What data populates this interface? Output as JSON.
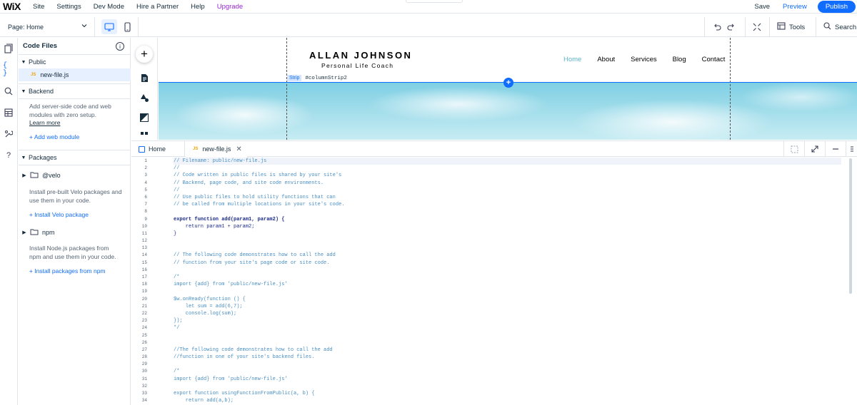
{
  "topbar": {
    "logo": "WiX",
    "menu": [
      "Site",
      "Settings",
      "Dev Mode",
      "Hire a Partner",
      "Help",
      "Upgrade"
    ],
    "save": "Save",
    "preview": "Preview",
    "publish": "Publish"
  },
  "secondbar": {
    "page_label": "Page: Home",
    "tools": "Tools",
    "search": "Search"
  },
  "files_panel": {
    "title": "Code Files",
    "public": "Public",
    "public_file": "new-file.js",
    "js_badge": "JS",
    "backend": "Backend",
    "backend_desc": "Add server-side code and web modules with zero setup.",
    "learn_more": "Learn more",
    "add_web_module": "+ Add web module",
    "packages": "Packages",
    "velo": "@velo",
    "velo_desc": "Install pre-built Velo packages and use them in your code.",
    "install_velo": "+ Install Velo package",
    "npm": "npm",
    "npm_desc": "Install Node.js packages from npm and use them in your code.",
    "install_npm": "+ Install packages from npm"
  },
  "canvas": {
    "site_name": "ALLAN JOHNSON",
    "site_subtitle": "Personal Life Coach",
    "nav": [
      "Home",
      "About",
      "Services",
      "Blog",
      "Contact"
    ],
    "strip_label": "Strip",
    "strip_id": "#columnStrip2"
  },
  "editor": {
    "tabs": [
      {
        "label": "Home"
      },
      {
        "label": "new-file.js"
      }
    ],
    "lines": [
      {
        "n": "1",
        "t": "// Filename: public/new-file.js",
        "k": "comment"
      },
      {
        "n": "2",
        "t": "//",
        "k": "comment"
      },
      {
        "n": "3",
        "t": "// Code written in public files is shared by your site's",
        "k": "comment"
      },
      {
        "n": "4",
        "t": "// Backend, page code, and site code environments.",
        "k": "comment"
      },
      {
        "n": "5",
        "t": "//",
        "k": "comment"
      },
      {
        "n": "6",
        "t": "// Use public files to hold utility functions that can",
        "k": "comment"
      },
      {
        "n": "7",
        "t": "// be called from multiple locations in your site's code.",
        "k": "comment"
      },
      {
        "n": "8",
        "t": "",
        "k": "plain"
      },
      {
        "n": "9",
        "t": "export function add(param1, param2) {",
        "k": "kw"
      },
      {
        "n": "10",
        "t": "    return param1 + param2;",
        "k": "kw"
      },
      {
        "n": "11",
        "t": "}",
        "k": "kw"
      },
      {
        "n": "12",
        "t": "",
        "k": "plain"
      },
      {
        "n": "13",
        "t": "",
        "k": "plain"
      },
      {
        "n": "14",
        "t": "// The following code demonstrates how to call the add",
        "k": "comment"
      },
      {
        "n": "15",
        "t": "// function from your site's page code or site code.",
        "k": "comment"
      },
      {
        "n": "16",
        "t": "",
        "k": "plain"
      },
      {
        "n": "17",
        "t": "/*",
        "k": "comment"
      },
      {
        "n": "18",
        "t": "import {add} from 'public/new-file.js'",
        "k": "comment"
      },
      {
        "n": "19",
        "t": "",
        "k": "plain"
      },
      {
        "n": "20",
        "t": "$w.onReady(function () {",
        "k": "comment"
      },
      {
        "n": "21",
        "t": "    let sum = add(6,7);",
        "k": "comment"
      },
      {
        "n": "22",
        "t": "    console.log(sum);",
        "k": "comment"
      },
      {
        "n": "23",
        "t": "});",
        "k": "comment"
      },
      {
        "n": "24",
        "t": "*/",
        "k": "comment"
      },
      {
        "n": "25",
        "t": "",
        "k": "plain"
      },
      {
        "n": "26",
        "t": "",
        "k": "plain"
      },
      {
        "n": "27",
        "t": "//The following code demonstrates how to call the add",
        "k": "comment"
      },
      {
        "n": "28",
        "t": "//function in one of your site's backend files.",
        "k": "comment"
      },
      {
        "n": "29",
        "t": "",
        "k": "plain"
      },
      {
        "n": "30",
        "t": "/*",
        "k": "comment"
      },
      {
        "n": "31",
        "t": "import {add} from 'public/new-file.js'",
        "k": "comment"
      },
      {
        "n": "32",
        "t": "",
        "k": "plain"
      },
      {
        "n": "33",
        "t": "export function usingFunctionFromPublic(a, b) {",
        "k": "comment"
      },
      {
        "n": "34",
        "t": "    return add(a,b);",
        "k": "comment"
      }
    ]
  },
  "colors": {
    "accent": "#116dff",
    "upgrade": "#9a27d5",
    "nav_active": "#5fb3c9"
  }
}
